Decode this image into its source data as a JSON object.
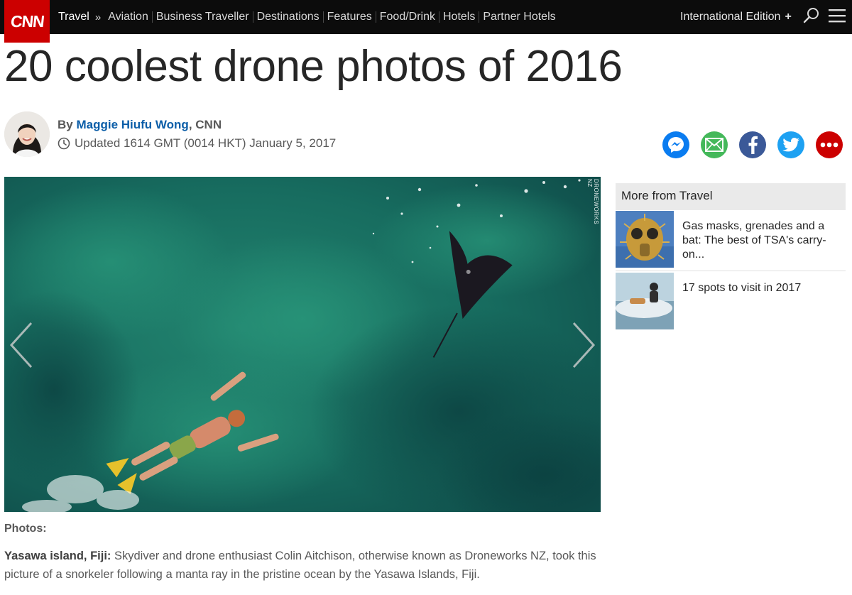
{
  "brand": {
    "logo_text": "CNN",
    "color": "#cc0000"
  },
  "nav": {
    "section": "Travel",
    "separator": "»",
    "items": [
      "Aviation",
      "Business Traveller",
      "Destinations",
      "Features",
      "Food/Drink",
      "Hotels",
      "Partner Hotels"
    ],
    "edition": "International Edition",
    "edition_plus": "+"
  },
  "article": {
    "headline": "20 coolest drone photos of 2016",
    "byline_prefix": "By ",
    "author": "Maggie Hiufu Wong",
    "byline_suffix": ", CNN",
    "updated": "Updated 1614 GMT (0014 HKT) January 5, 2017"
  },
  "share": {
    "icons": [
      "messenger-icon",
      "email-icon",
      "facebook-icon",
      "twitter-icon",
      "more-icon"
    ],
    "colors": {
      "messenger": "#0a7cf0",
      "email": "#44b85a",
      "facebook": "#3b5998",
      "twitter": "#1da1f2",
      "more": "#cc0000"
    }
  },
  "gallery": {
    "watermark": "DRONEWORKS NZ",
    "photos_label": "Photos:",
    "caption_location": "Yasawa island, Fiji:",
    "caption_text": " Skydiver and drone enthusiast Colin Aitchison, otherwise known as Droneworks NZ, took this picture of a snorkeler following a manta ray in the pristine ocean by the Yasawa Islands, Fiji."
  },
  "sidebar": {
    "header": "More from Travel",
    "items": [
      {
        "title": "Gas masks, grenades and a bat: The best of TSA's carry-on..."
      },
      {
        "title": "17 spots to visit in 2017"
      }
    ]
  }
}
